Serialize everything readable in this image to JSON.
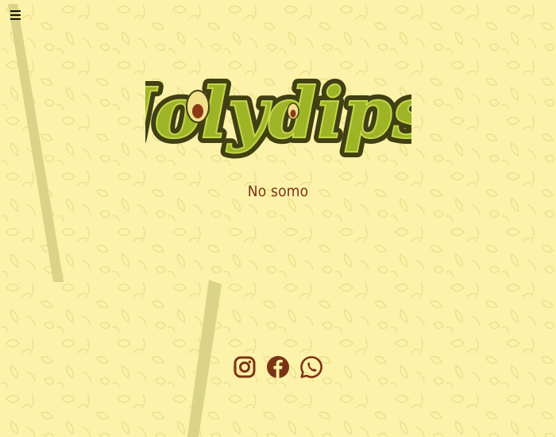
{
  "brand": {
    "logo_text": "Jolydips",
    "colors": {
      "background": "#fdf2a9",
      "logo_fill": "#9db427",
      "logo_outline": "#404012",
      "text": "#7a3415",
      "icons": "#7a3415"
    }
  },
  "menu": {
    "icon": "hamburger-icon"
  },
  "main": {
    "subtitle": "No somo"
  },
  "social": [
    {
      "name": "instagram",
      "icon": "instagram-icon"
    },
    {
      "name": "facebook",
      "icon": "facebook-icon"
    },
    {
      "name": "whatsapp",
      "icon": "whatsapp-icon"
    }
  ]
}
